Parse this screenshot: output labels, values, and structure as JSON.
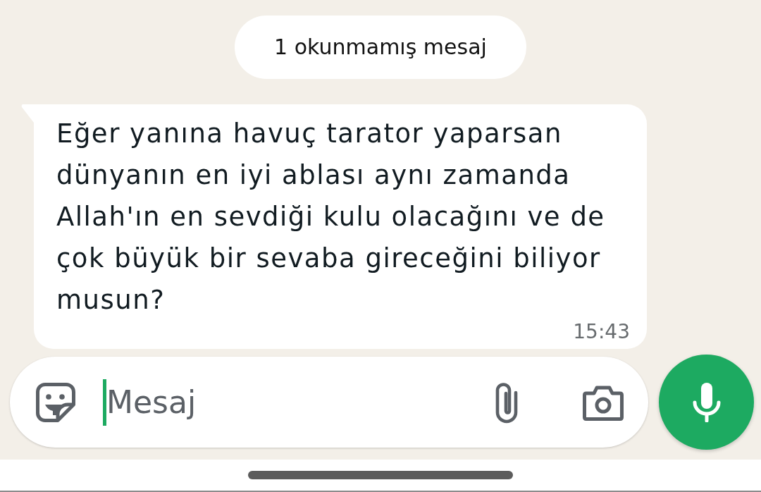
{
  "unread_banner": {
    "text": "1 okunmamış mesaj"
  },
  "messages": [
    {
      "kind": "incoming",
      "text": "Eğer yanına havuç tarator yaparsan dünyanın en iyi ablası aynı zamanda Allah'ın en sevdiği kulu olacağını ve de çok büyük bir sevaba gireceğini biliyor musun?",
      "time": "15:43"
    }
  ],
  "composer": {
    "placeholder": "Mesaj",
    "focused": true
  }
}
